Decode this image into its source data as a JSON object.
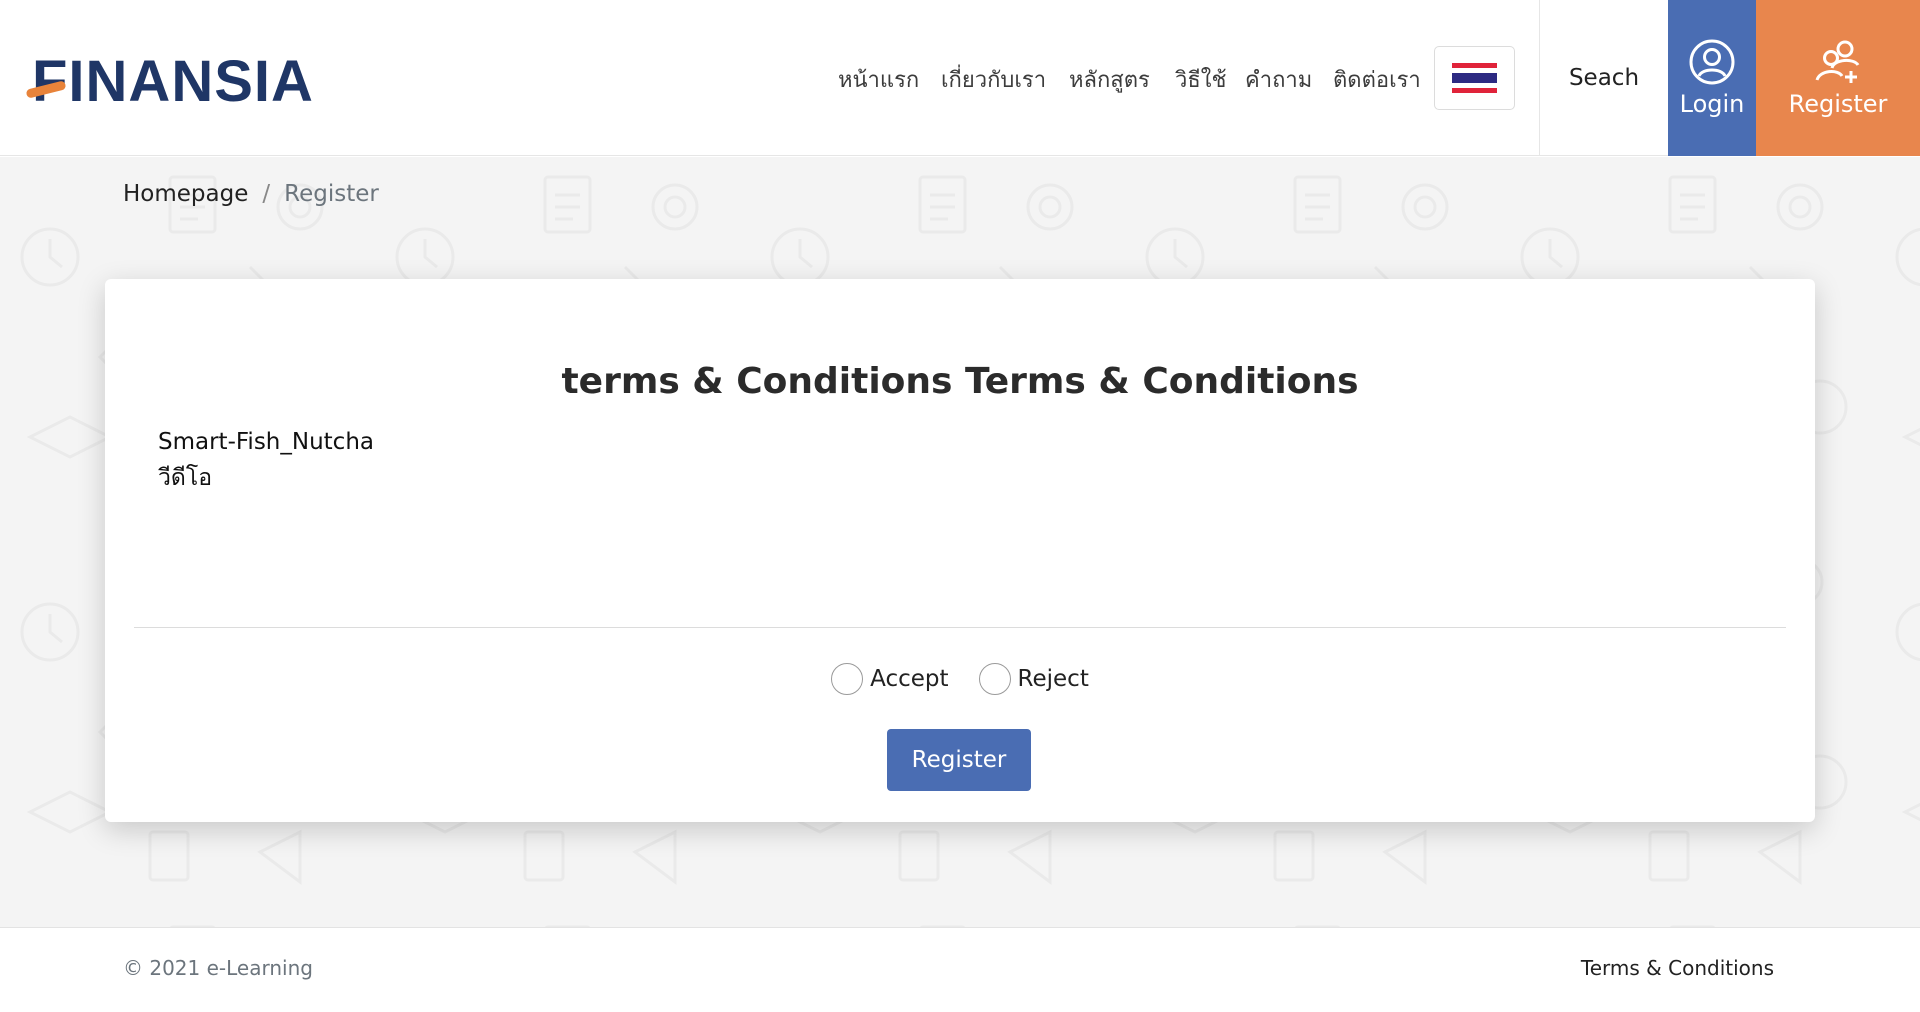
{
  "header": {
    "logo_text": "FINANSIA",
    "nav": [
      {
        "label": "หน้าแรก"
      },
      {
        "label": "เกี่ยวกับเรา"
      },
      {
        "label": "หลักสูตร"
      },
      {
        "label": "วิธีใช้"
      },
      {
        "label": "คำถาม"
      },
      {
        "label": "ติดต่อเรา"
      }
    ],
    "language_icon": "thailand-flag-icon",
    "search_label": "Seach",
    "login_label": "Login",
    "register_label": "Register"
  },
  "breadcrumb": {
    "home": "Homepage",
    "separator": "/",
    "current": "Register"
  },
  "card": {
    "title": "terms & Conditions Terms & Conditions",
    "body_lines": [
      "Smart-Fish_Nutcha",
      "วีดีโอ"
    ],
    "accept_label": "Accept",
    "reject_label": "Reject",
    "submit_label": "Register"
  },
  "footer": {
    "copyright": "© 2021 e-Learning",
    "terms_link": "Terms & Conditions"
  },
  "colors": {
    "brand_blue": "#4a6db3",
    "brand_orange": "#e8864d",
    "logo_navy": "#1f3666"
  }
}
